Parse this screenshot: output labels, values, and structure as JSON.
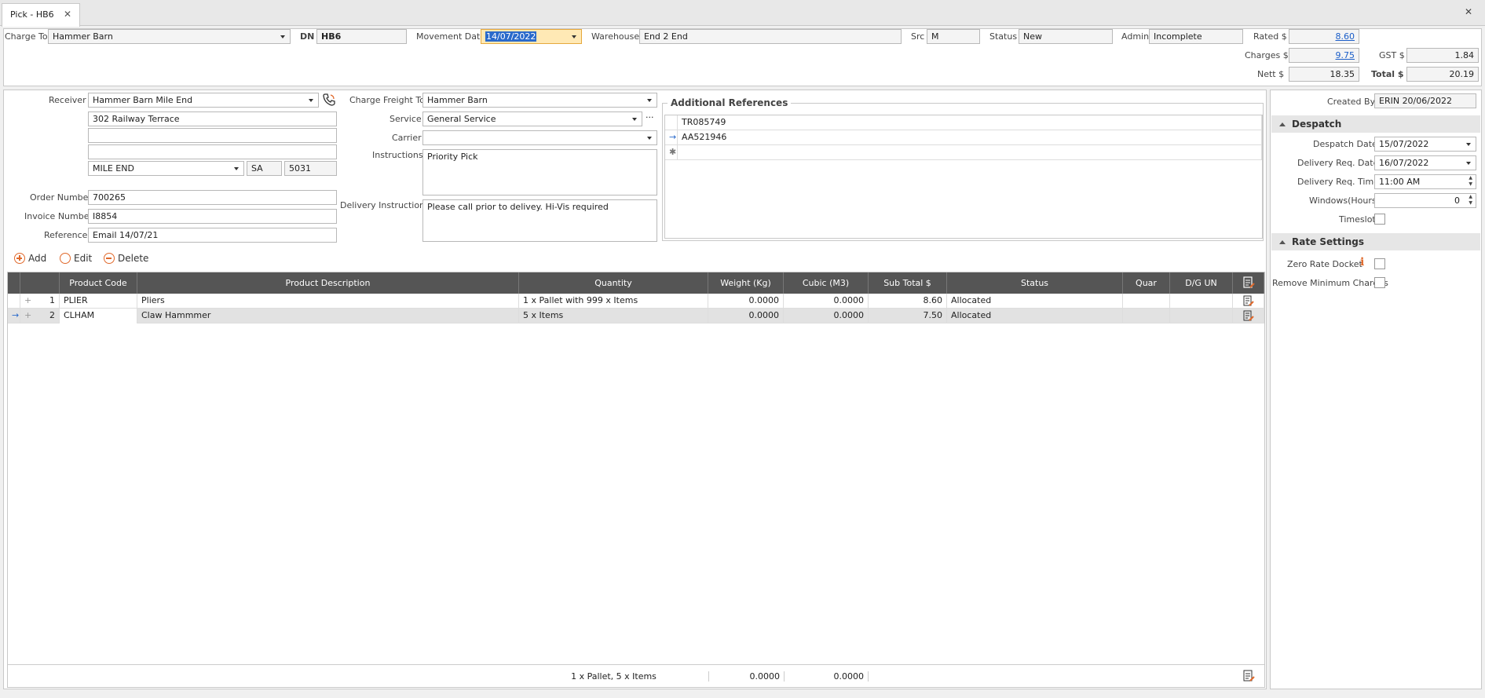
{
  "tab": {
    "title": "Pick - HB6",
    "close": "✕"
  },
  "window": {
    "close": "✕"
  },
  "header": {
    "charge_to_label": "Charge To",
    "charge_to": "Hammer Barn",
    "dn_label": "DN",
    "dn": "HB6",
    "movement_date_label": "Movement Date",
    "movement_date": "14/07/2022",
    "warehouse_label": "Warehouse",
    "warehouse": "End 2 End",
    "src_label": "Src",
    "src": "M",
    "status_label": "Status",
    "status": "New",
    "admin_label": "Admin",
    "admin": "Incomplete",
    "rated_label": "Rated $",
    "rated": "8.60",
    "charges_label": "Charges $",
    "charges": "9.75",
    "gst_label": "GST $",
    "gst": "1.84",
    "nett_label": "Nett $",
    "nett": "18.35",
    "total_label": "Total $",
    "total": "20.19"
  },
  "receiver": {
    "label": "Receiver",
    "name": "Hammer Barn Mile End",
    "address1": "302 Railway Terrace",
    "address2": "",
    "address3": "",
    "suburb": "MILE END",
    "state": "SA",
    "postcode": "5031",
    "order_number_label": "Order Number",
    "order_number": "700265",
    "invoice_number_label": "Invoice Number",
    "invoice_number": "I8854",
    "reference_label": "Reference",
    "reference": "Email 14/07/21"
  },
  "freight": {
    "charge_freight_to_label": "Charge Freight To",
    "charge_freight_to": "Hammer Barn",
    "service_label": "Service",
    "service": "General Service",
    "carrier_label": "Carrier",
    "carrier": "",
    "instructions_label": "Instructions",
    "instructions": "Priority Pick",
    "delivery_instructions_label": "Delivery Instructions",
    "delivery_instructions": "Please call prior to delivey. Hi-Vis required"
  },
  "references": {
    "title": "Additional References",
    "rows": [
      "TR085749",
      "AA521946",
      ""
    ]
  },
  "toolbar": {
    "add": "Add",
    "edit": "Edit",
    "delete": "Delete"
  },
  "grid": {
    "columns": [
      "Product Code",
      "Product Description",
      "Quantity",
      "Weight (Kg)",
      "Cubic (M3)",
      "Sub Total $",
      "Status",
      "Quar",
      "D/G UN"
    ],
    "rows": [
      {
        "n": "1",
        "code": "PLIER",
        "desc": "Pliers",
        "qty": "1 x Pallet with 999 x Items",
        "weight": "0.0000",
        "cubic": "0.0000",
        "subtotal": "8.60",
        "status": "Allocated",
        "quar": "",
        "dg": ""
      },
      {
        "n": "2",
        "code": "CLHAM",
        "desc": "Claw Hammmer",
        "qty": "5 x Items",
        "weight": "0.0000",
        "cubic": "0.0000",
        "subtotal": "7.50",
        "status": "Allocated",
        "quar": "",
        "dg": ""
      }
    ],
    "footer": {
      "qty": "1 x Pallet, 5 x Items",
      "weight": "0.0000",
      "cubic": "0.0000"
    }
  },
  "side": {
    "created_by_label": "Created By",
    "created_by": "ERIN 20/06/2022",
    "despatch_title": "Despatch",
    "despatch_date_label": "Despatch Date",
    "despatch_date": "15/07/2022",
    "delivery_req_date_label": "Delivery Req. Date",
    "delivery_req_date": "16/07/2022",
    "delivery_req_time_label": "Delivery Req. Time",
    "delivery_req_time": "11:00 AM",
    "windows_label": "Windows(Hours)",
    "windows": "0",
    "timeslot_label": "Timeslot",
    "rate_title": "Rate Settings",
    "zero_rate_label": "Zero Rate Docket",
    "remove_min_label": "Remove Minimum Charges"
  }
}
